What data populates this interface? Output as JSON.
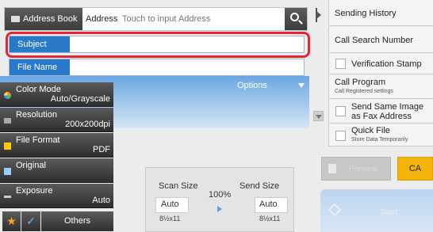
{
  "address_bar": {
    "address_book_label": "Address Book",
    "address_label": "Address",
    "input_placeholder": "Touch to input Address",
    "search_icon": "search-icon"
  },
  "fields": {
    "subject_label": "Subject",
    "subject_value": "",
    "file_name_label": "File Name",
    "file_name_value": ""
  },
  "options_label": "Options",
  "settings": [
    {
      "label": "Color Mode",
      "value": "Auto/Grayscale",
      "icon": "color-mode-icon"
    },
    {
      "label": "Resolution",
      "value": "200x200dpi",
      "icon": "resolution-icon"
    },
    {
      "label": "File Format",
      "value": "PDF",
      "icon": "file-format-icon"
    },
    {
      "label": "Original",
      "value": "",
      "icon": "original-icon"
    },
    {
      "label": "Exposure",
      "value": "Auto",
      "icon": "exposure-icon"
    }
  ],
  "bottom_left": {
    "star_glyph": "★",
    "check_glyph": "✓",
    "others_label": "Others"
  },
  "size_panel": {
    "scan_size_label": "Scan Size",
    "scan_size_value": "Auto",
    "scan_size_paper": "8½x11",
    "ratio": "100%",
    "send_size_label": "Send Size",
    "send_size_value": "Auto",
    "send_size_paper": "8½x11"
  },
  "right_panel": {
    "sending_history": "Sending History",
    "call_search_number": "Call Search Number",
    "verification_stamp": "Verification Stamp",
    "call_program": "Call Program",
    "call_program_sub": "Call Registered settings",
    "send_same_image_line1": "Send Same Image",
    "send_same_image_line2": "as Fax Address",
    "quick_file": "Quick File",
    "quick_file_sub": "Store Data Temporarily"
  },
  "actions": {
    "preview_label": "Preview",
    "ca_label": "CA",
    "start_label": "Start"
  },
  "colors": {
    "accent_blue": "#2a79c9",
    "highlight_red": "#e3262f",
    "ca_yellow": "#f5b40a"
  }
}
